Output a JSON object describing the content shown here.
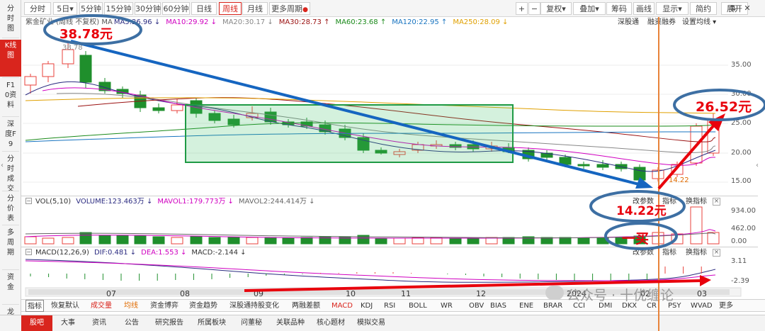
{
  "left_sidebar": {
    "items": [
      "分时图",
      "K线图",
      "F10资料",
      "深度F9",
      "分时成交",
      "分价表",
      "多周期",
      "资金",
      "龙虎"
    ],
    "active_index": 1
  },
  "toolbar": {
    "periods": [
      "分时",
      "5日▾",
      "5分钟",
      "15分钟",
      "30分钟",
      "60分钟",
      "日线",
      "周线",
      "月线",
      "更多周期"
    ],
    "active_period": "周线",
    "right_buttons": [
      "+",
      "−",
      "复权▾",
      "叠加▾",
      "筹码",
      "画线",
      "显示▾",
      "简约",
      "展开"
    ],
    "icons": [
      "expand-icon",
      "close-icon"
    ]
  },
  "indicator_line": {
    "name": "紫金矿业 (周线 不复权)",
    "ma": [
      {
        "label": "MA",
        "color": "#555555"
      },
      {
        "label": "MA5:26.96 ↓",
        "color": "#2b2b80"
      },
      {
        "label": "MA10:29.92 ↓",
        "color": "#d000c0"
      },
      {
        "label": "MA20:30.17 ↓",
        "color": "#888888"
      },
      {
        "label": "MA30:28.73 ↑",
        "color": "#9a1010"
      },
      {
        "label": "MA60:23.68 ↑",
        "color": "#1a8a1a"
      },
      {
        "label": "MA120:22.95 ↑",
        "color": "#1874c0"
      },
      {
        "label": "MA250:28.09 ↓",
        "color": "#e0a000"
      }
    ]
  },
  "top_links": [
    "深股通",
    "融资融券",
    "设置均线 ▾"
  ],
  "price_axis": [
    "35.00",
    "30.00",
    "25.00",
    "20.00",
    "15.00"
  ],
  "chart_labels": {
    "high": "38.78",
    "low": "14.22"
  },
  "volume": {
    "header": [
      {
        "label": "VOL(5,10)",
        "color": "#333333"
      },
      {
        "label": "VOLUME:123.463万 ↓",
        "color": "#2b2b80"
      },
      {
        "label": "MAVOL1:179.773万 ↓",
        "color": "#d000c0"
      },
      {
        "label": "MAVOL2:244.414万 ↓",
        "color": "#666666"
      }
    ],
    "axis": [
      "934.00",
      "462.00",
      "0.00"
    ],
    "buttons": [
      "改参数",
      "指标",
      "换指标"
    ]
  },
  "macd": {
    "header": [
      {
        "label": "MACD(12,26,9)",
        "color": "#333333"
      },
      {
        "label": "DIF:0.481 ↓",
        "color": "#2b2b80"
      },
      {
        "label": "DEA:1.553 ↓",
        "color": "#d000c0"
      },
      {
        "label": "MACD:-2.144 ↓",
        "color": "#333333"
      }
    ],
    "axis": [
      "3.11",
      "-2.39"
    ],
    "buttons": [
      "改参数",
      "指标",
      "换指标"
    ]
  },
  "time_axis": [
    "07",
    "08",
    "09",
    "10",
    "11",
    "12",
    "2024",
    "02",
    "03"
  ],
  "indicator_tabs": [
    {
      "label": "指标",
      "style": "on"
    },
    {
      "label": "恢复默认",
      "style": ""
    },
    {
      "label": "成交量",
      "style": "red"
    },
    {
      "label": "均线",
      "style": "org"
    },
    {
      "label": "资金博弈",
      "style": ""
    },
    {
      "label": "资金趋势",
      "style": ""
    },
    {
      "label": "深股通持股变化",
      "style": ""
    },
    {
      "label": "两融差额",
      "style": ""
    },
    {
      "label": "MACD",
      "style": "red"
    },
    {
      "label": "KDJ",
      "style": ""
    },
    {
      "label": "RSI",
      "style": ""
    },
    {
      "label": "BOLL",
      "style": ""
    },
    {
      "label": "WR",
      "style": ""
    },
    {
      "label": "OBV",
      "style": ""
    },
    {
      "label": "BIAS",
      "style": ""
    },
    {
      "label": "ENE",
      "style": ""
    },
    {
      "label": "BRAR",
      "style": ""
    },
    {
      "label": "CCI",
      "style": ""
    },
    {
      "label": "DMI",
      "style": ""
    },
    {
      "label": "DKX",
      "style": ""
    },
    {
      "label": "CR",
      "style": ""
    },
    {
      "label": "PSY",
      "style": ""
    },
    {
      "label": "WVAD",
      "style": ""
    },
    {
      "label": "更多",
      "style": ""
    }
  ],
  "bottom_tabs": [
    "股吧",
    "大事",
    "资讯",
    "公告",
    "研究报告",
    "所属板块",
    "问董秘",
    "关联品种",
    "核心题材",
    "模拟交易"
  ],
  "annotations": {
    "start_price": "38.78元",
    "end_price": "26.52元",
    "low_price": "14.22元",
    "buy": "一买"
  },
  "watermark": "公众号 · 十优缠论",
  "colors": {
    "up": "#e8413b",
    "down": "#1f8f2c",
    "accent": "#d9251d",
    "annotation": "#e8000c",
    "arrow_blue": "#1565c0"
  }
}
